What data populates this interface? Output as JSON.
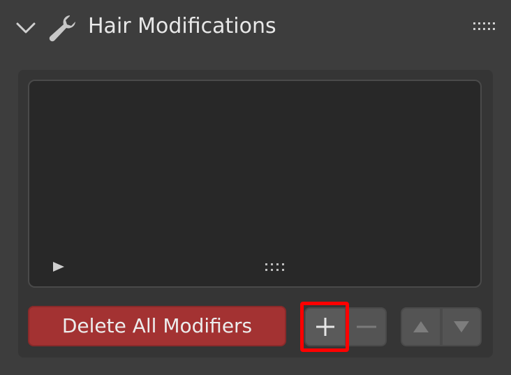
{
  "panel": {
    "title": "Hair Modifications",
    "expanded": true,
    "icons": {
      "collapse": "chevron-down-icon",
      "header": "wrench-icon",
      "drag": "drag-grip-icon"
    }
  },
  "modifier_list": {
    "items": [],
    "icons": {
      "expand": "play-triangle-icon",
      "resize": "resize-grip-icon"
    }
  },
  "toolbar": {
    "delete_all_label": "Delete All Modifiers",
    "add_icon": "plus-icon",
    "remove_icon": "minus-icon",
    "move_up_icon": "arrow-up-icon",
    "move_down_icon": "arrow-down-icon"
  },
  "colors": {
    "panel_bg": "#3d3d3d",
    "list_bg": "#282828",
    "delete_button": "#a33232",
    "highlight": "#ff0000"
  }
}
